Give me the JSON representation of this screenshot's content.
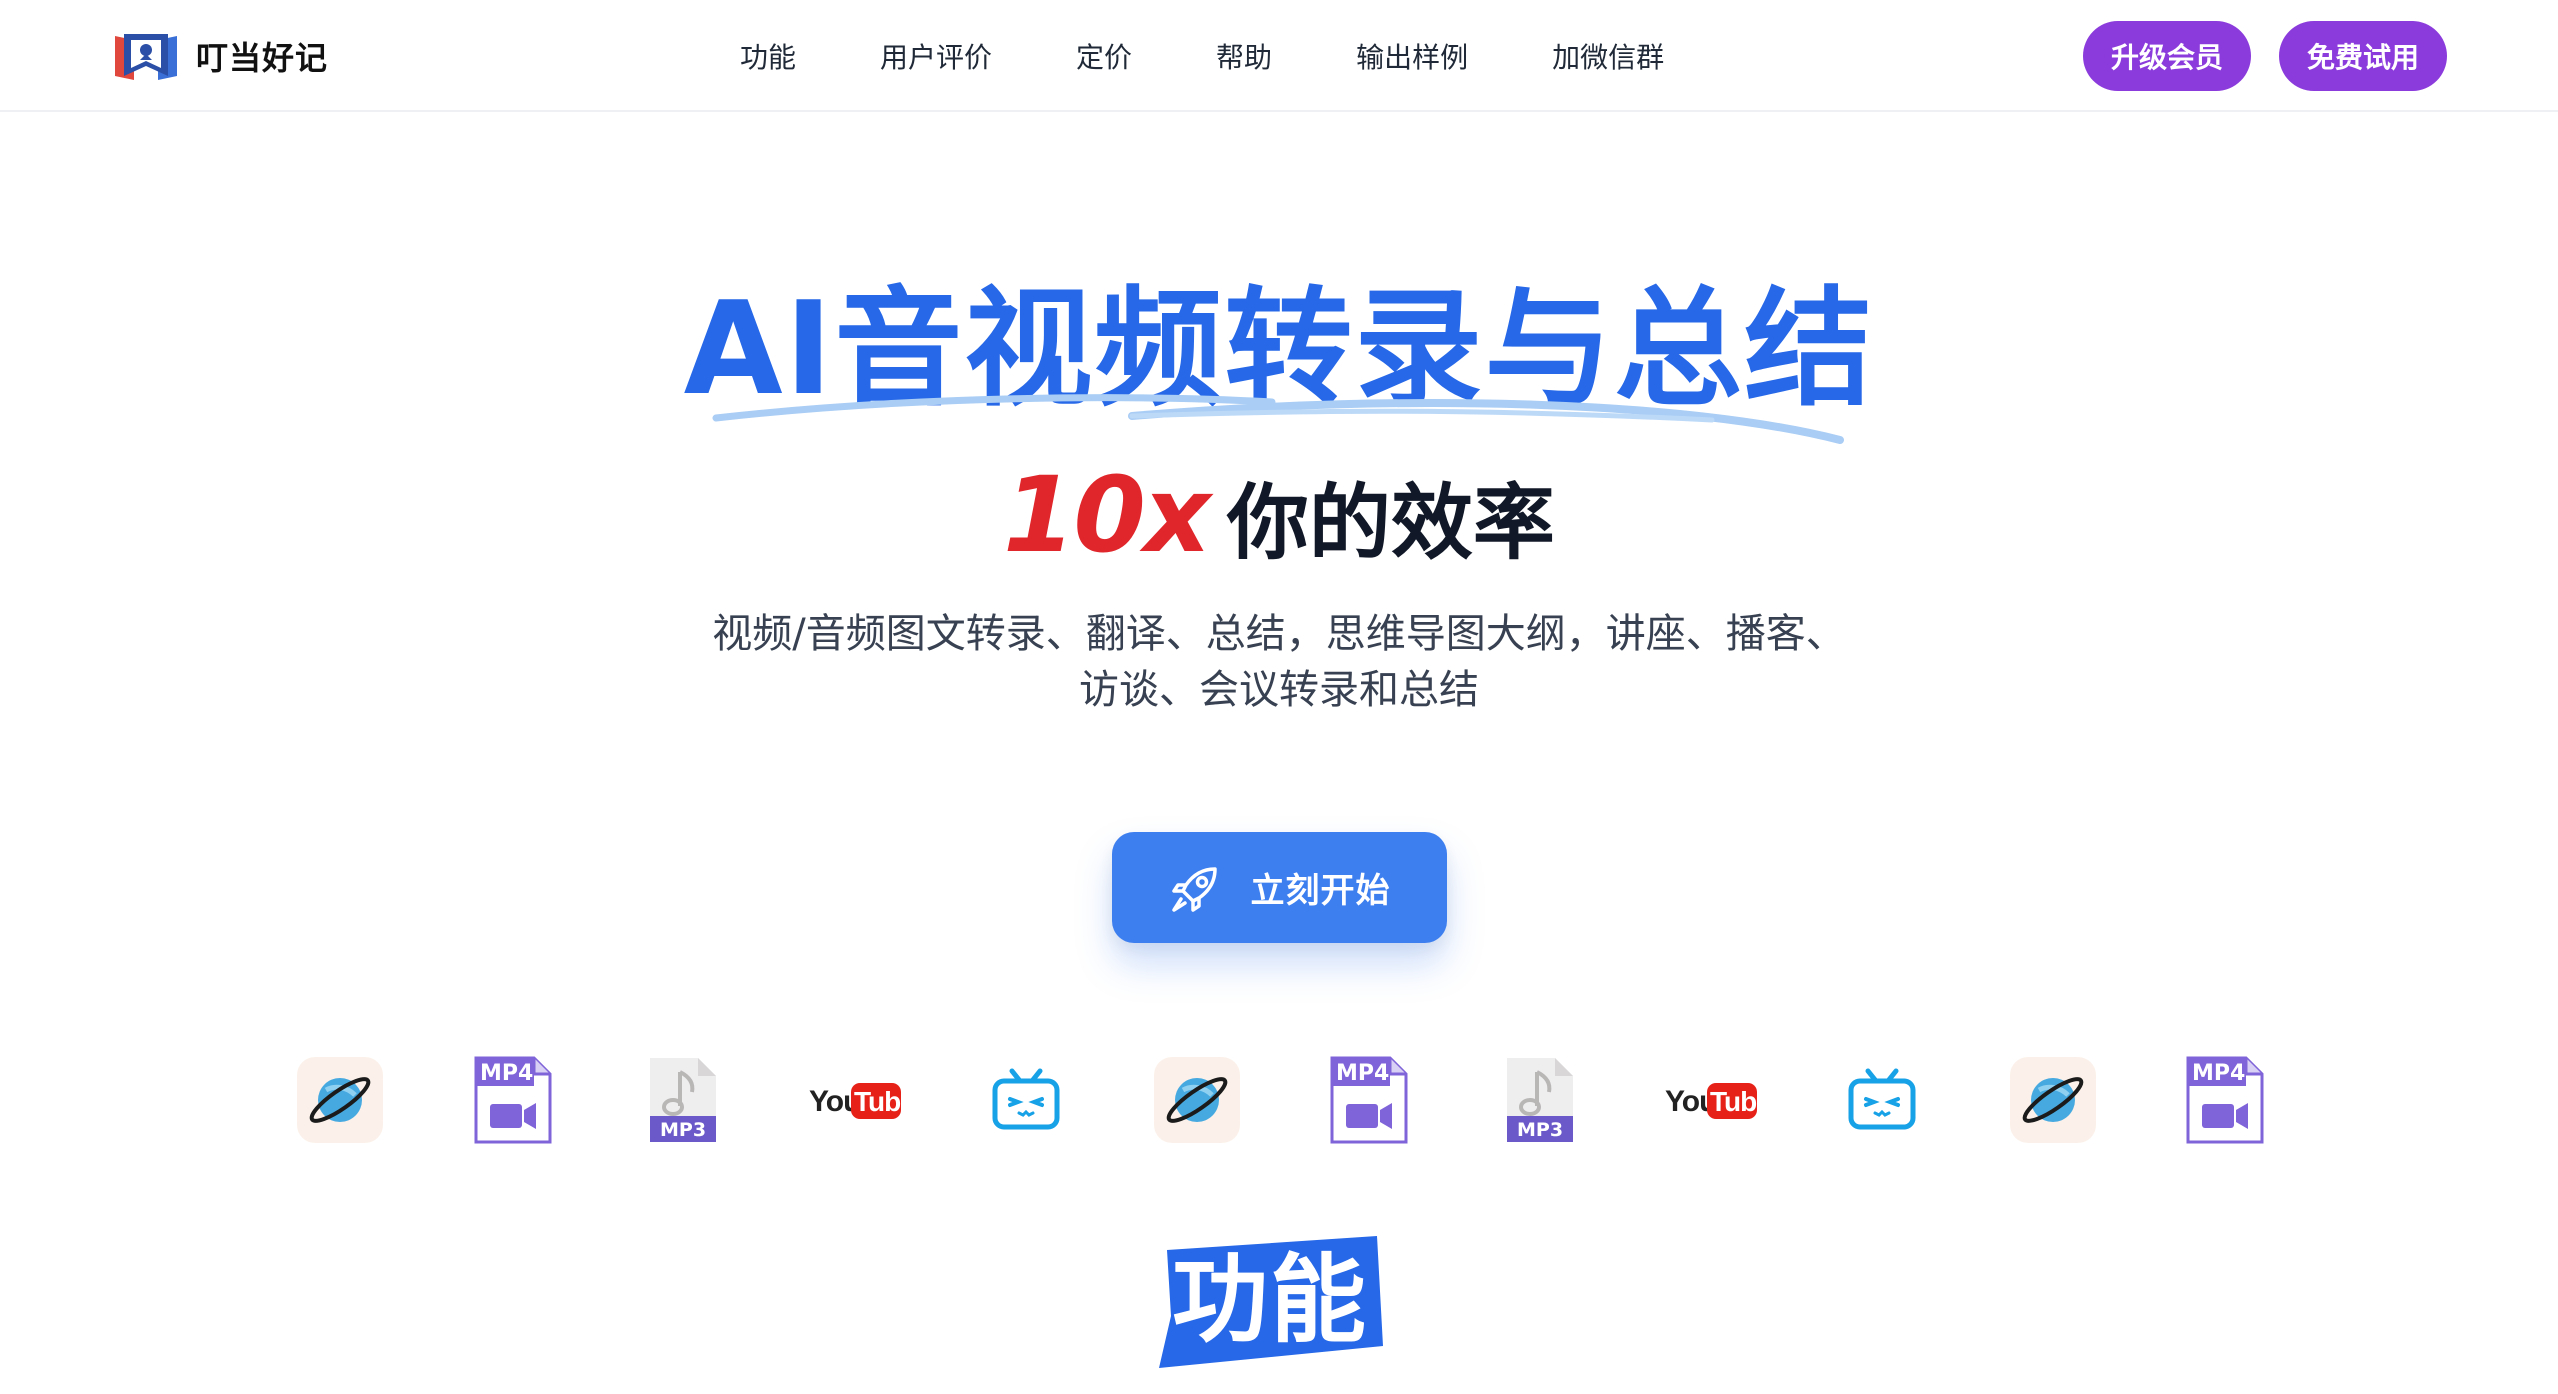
{
  "brand": {
    "name": "叮当好记"
  },
  "nav": {
    "items": [
      {
        "label": "功能"
      },
      {
        "label": "用户评价"
      },
      {
        "label": "定价"
      },
      {
        "label": "帮助"
      },
      {
        "label": "输出样例"
      },
      {
        "label": "加微信群"
      }
    ]
  },
  "header_buttons": {
    "upgrade": "升级会员",
    "trial": "免费试用"
  },
  "hero": {
    "title": "AI音视频转录与总结",
    "multiplier": "10x",
    "subtitle": "你的效率",
    "description_line1": "视频/音频图文转录、翻译、总结，思维导图大纲，讲座、播客、",
    "description_line2": "访谈、会议转录和总结",
    "cta_label": "立刻开始"
  },
  "logo_labels": {
    "mp4": "MP4",
    "mp3": "MP3",
    "you": "You",
    "tube": "Tube"
  },
  "section": {
    "title": "功能"
  },
  "colors": {
    "primary_blue": "#2668e8",
    "cta_blue": "#3e7ff0",
    "purple": "#8b3bdc",
    "red": "#e0262b",
    "underline": "#a9cdf5"
  },
  "icons": {
    "brand_logo": "book-bookmark-logo",
    "cta": "rocket-icon",
    "sources": [
      "planet-icon",
      "mp4-file-icon",
      "mp3-file-icon",
      "youtube-logo",
      "bilibili-icon",
      "planet-icon",
      "mp4-file-icon",
      "mp3-file-icon",
      "youtube-logo",
      "bilibili-icon",
      "planet-icon",
      "mp4-file-icon"
    ]
  }
}
